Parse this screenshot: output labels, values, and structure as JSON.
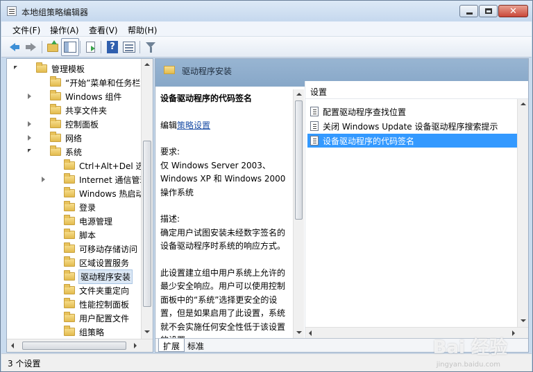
{
  "window": {
    "title": "本地组策略编辑器"
  },
  "menu": [
    {
      "label": "文件(F)"
    },
    {
      "label": "操作(A)"
    },
    {
      "label": "查看(V)"
    },
    {
      "label": "帮助(H)"
    }
  ],
  "toolbar": {
    "icons": [
      "back-arrow-icon",
      "forward-arrow-icon",
      "folder-up-icon",
      "show-hide-tree-icon",
      "export-list-icon",
      "help-icon",
      "properties-view-icon",
      "filter-icon"
    ]
  },
  "tree": {
    "items": [
      {
        "label": "管理模板",
        "indent": 1,
        "expander": "open"
      },
      {
        "label": "“开始”菜单和任务栏",
        "indent": 2,
        "expander": "none"
      },
      {
        "label": "Windows 组件",
        "indent": 2,
        "expander": "closed"
      },
      {
        "label": "共享文件夹",
        "indent": 2,
        "expander": "none"
      },
      {
        "label": "控制面板",
        "indent": 2,
        "expander": "closed"
      },
      {
        "label": "网络",
        "indent": 2,
        "expander": "closed"
      },
      {
        "label": "系统",
        "indent": 2,
        "expander": "open"
      },
      {
        "label": "Ctrl+Alt+Del 选项",
        "indent": 3,
        "expander": "none"
      },
      {
        "label": "Internet 通信管理",
        "indent": 3,
        "expander": "closed"
      },
      {
        "label": "Windows 热启动",
        "indent": 3,
        "expander": "none"
      },
      {
        "label": "登录",
        "indent": 3,
        "expander": "none"
      },
      {
        "label": "电源管理",
        "indent": 3,
        "expander": "none"
      },
      {
        "label": "脚本",
        "indent": 3,
        "expander": "none"
      },
      {
        "label": "可移动存储访问",
        "indent": 3,
        "expander": "none"
      },
      {
        "label": "区域设置服务",
        "indent": 3,
        "expander": "none"
      },
      {
        "label": "驱动程序安装",
        "indent": 3,
        "expander": "none",
        "selected": true
      },
      {
        "label": "文件夹重定向",
        "indent": 3,
        "expander": "none"
      },
      {
        "label": "性能控制面板",
        "indent": 3,
        "expander": "none"
      },
      {
        "label": "用户配置文件",
        "indent": 3,
        "expander": "none"
      },
      {
        "label": "组策略",
        "indent": 3,
        "expander": "none"
      }
    ]
  },
  "right": {
    "header_title": "驱动程序安装",
    "description": {
      "title": "设备驱动程序的代码签名",
      "edit_prefix": "编辑",
      "edit_link": "策略设置",
      "req_label": "要求:",
      "req_text": "仅 Windows Server 2003、Windows XP 和 Windows 2000 操作系统",
      "desc_label": "描述:",
      "desc_text1": "确定用户试图安装未经数字签名的设备驱动程序时系统的响应方式。",
      "desc_text2": "此设置建立组中用户系统上允许的最少安全响应。用户可以使用控制面板中的“系统”选择更安全的设置，但是如果启用了此设置，系统就不会实施任何安全性低于该设置的设置。"
    },
    "settings": {
      "header": "设置",
      "items": [
        {
          "label": "配置驱动程序查找位置"
        },
        {
          "label": "关闭 Windows Update 设备驱动程序搜索提示"
        },
        {
          "label": "设备驱动程序的代码签名",
          "selected": true
        }
      ]
    },
    "tabs": [
      {
        "label": "扩展",
        "active": true
      },
      {
        "label": "标准",
        "active": false
      }
    ]
  },
  "status": {
    "text": "3 个设置"
  },
  "watermark": {
    "text": "Bai 经验",
    "sub": "jingyan.baidu.com"
  },
  "colors": {
    "selection": "#3399ff",
    "header": "#8faccc",
    "link": "#1d4fa6"
  }
}
